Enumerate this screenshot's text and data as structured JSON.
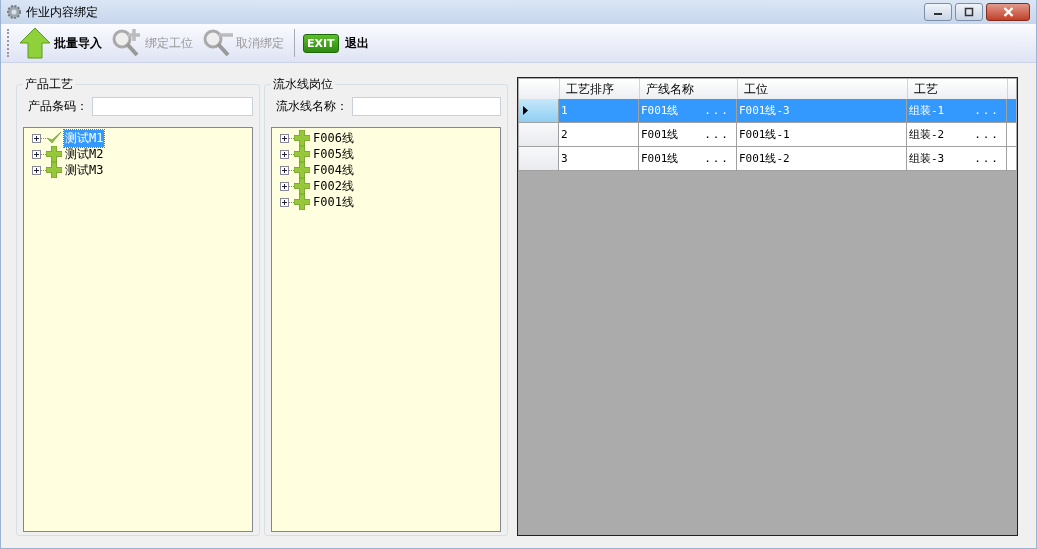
{
  "window": {
    "title": "作业内容绑定"
  },
  "toolbar": [
    {
      "label": "批量导入",
      "kind": "import",
      "disabled": false
    },
    {
      "label": "绑定工位",
      "kind": "bind",
      "disabled": true
    },
    {
      "label": "取消绑定",
      "kind": "unbind",
      "disabled": true
    },
    {
      "label": "退出",
      "kind": "exit",
      "disabled": false,
      "icon_text": "EXIT"
    }
  ],
  "product_panel": {
    "title": "产品工艺",
    "field_label": "产品条码：",
    "tree": [
      {
        "label": "测试M1",
        "kind": "check",
        "selected": true
      },
      {
        "label": "测试M2",
        "kind": "plus",
        "selected": false
      },
      {
        "label": "测试M3",
        "kind": "plus",
        "selected": false
      }
    ]
  },
  "line_panel": {
    "title": "流水线岗位",
    "field_label": "流水线名称：",
    "tree": [
      {
        "label": "F006线",
        "kind": "plus",
        "selected": false
      },
      {
        "label": "F005线",
        "kind": "plus",
        "selected": false
      },
      {
        "label": "F004线",
        "kind": "plus",
        "selected": false
      },
      {
        "label": "F002线",
        "kind": "plus",
        "selected": false
      },
      {
        "label": "F001线",
        "kind": "plus",
        "selected": false
      }
    ]
  },
  "grid": {
    "columns": [
      "工艺排序",
      "产线名称",
      "工位",
      "工艺"
    ],
    "rows": [
      {
        "selected": true,
        "cells": [
          {
            "text": "1"
          },
          {
            "text": "F001线",
            "button": "..."
          },
          {
            "text": "F001线-3"
          },
          {
            "text": "组装-1",
            "button": "..."
          }
        ]
      },
      {
        "selected": false,
        "cells": [
          {
            "text": "2"
          },
          {
            "text": "F001线",
            "button": "..."
          },
          {
            "text": "F001线-1"
          },
          {
            "text": "组装-2",
            "button": "..."
          }
        ]
      },
      {
        "selected": false,
        "cells": [
          {
            "text": "3"
          },
          {
            "text": "F001线",
            "button": "..."
          },
          {
            "text": "F001线-2"
          },
          {
            "text": "组装-3",
            "button": "..."
          }
        ]
      }
    ]
  }
}
